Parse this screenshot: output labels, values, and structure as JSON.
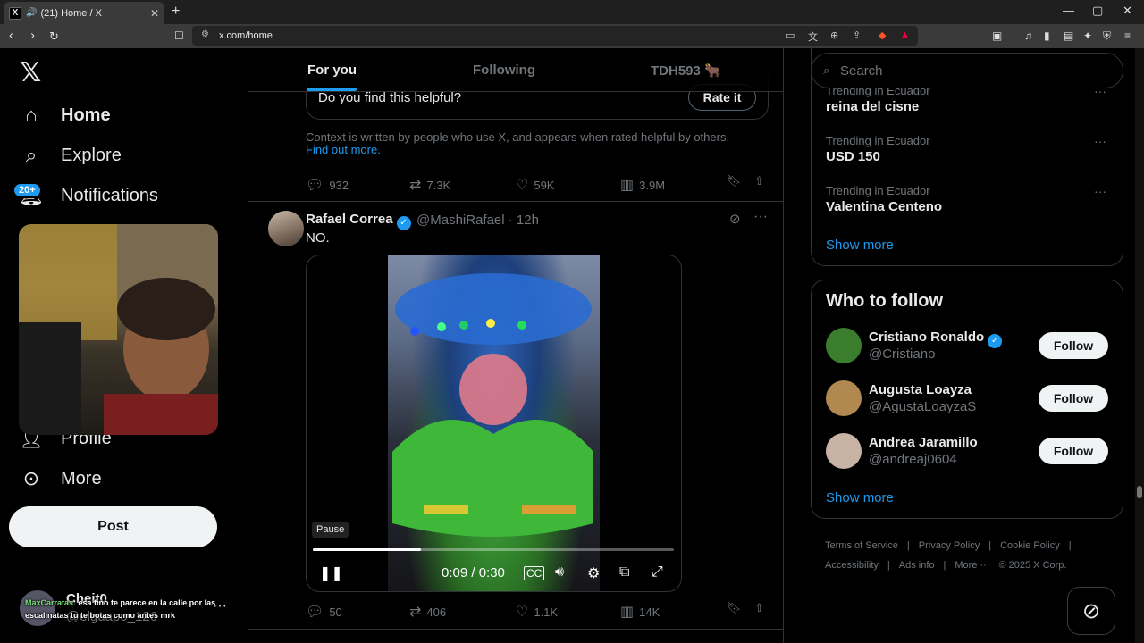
{
  "browser": {
    "tab_title": "(21) Home / X",
    "tab_favicon": "X",
    "new_tab": "+",
    "url": "x.com/home",
    "window_controls": [
      "—",
      "▢",
      "✕"
    ]
  },
  "nav": {
    "logo": "𝕏",
    "items": [
      {
        "label": "Home",
        "icon": "home-icon"
      },
      {
        "label": "Explore",
        "icon": "search-icon"
      },
      {
        "label": "Notifications",
        "icon": "bell-icon"
      },
      {
        "label": "Profile",
        "icon": "person-icon"
      },
      {
        "label": "More",
        "icon": "more-circle-icon"
      }
    ],
    "notifications_badge": "20+",
    "post_label": "Post",
    "account": {
      "name": "Cheit0",
      "handle": "@elguapo_126"
    }
  },
  "chat_overlay": {
    "user": "MaxCarratas",
    "message": ": esa fino te parece en la calle por las escalinatas tu te botas como antes mrk"
  },
  "feed": {
    "tabs": [
      "For you",
      "Following",
      "TDH593 🐂"
    ],
    "active_tab": 0,
    "note": {
      "question": "Do you find this helpful?",
      "rate_label": "Rate it",
      "context": "Context is written by people who use X, and appears when rated helpful by others.",
      "find_out_more": "Find out more."
    },
    "prev_actions": {
      "replies": "932",
      "reposts": "7.3K",
      "likes": "59K",
      "views": "3.9M"
    },
    "tweet": {
      "name": "Rafael Correa",
      "verified": "✓",
      "handle_time": "@MashiRafael · 12h",
      "text": "NO.",
      "video": {
        "tooltip": "Pause",
        "time": "0:09 / 0:30",
        "progress": 0.3
      },
      "actions": {
        "replies": "50",
        "reposts": "406",
        "likes": "1.1K",
        "views": "14K"
      }
    }
  },
  "sidebar": {
    "search_placeholder": "Search",
    "trends": [
      {
        "context": "Trending in Ecuador",
        "title": "reina del cisne"
      },
      {
        "context": "Trending in Ecuador",
        "title": "USD 150"
      },
      {
        "context": "Trending in Ecuador",
        "title": "Valentina Centeno"
      }
    ],
    "show_more": "Show more",
    "who_to_follow": {
      "title": "Who to follow",
      "users": [
        {
          "name": "Cristiano Ronaldo",
          "handle": "@Cristiano",
          "verified": true,
          "color": "#3a7d2c"
        },
        {
          "name": "Augusta Loayza",
          "handle": "@AgustaLoayzaS",
          "verified": false,
          "color": "#b08850"
        },
        {
          "name": "Andrea Jaramillo",
          "handle": "@andreaj0604",
          "verified": false,
          "color": "#c7b2a4"
        }
      ],
      "follow_label": "Follow",
      "show_more": "Show more"
    },
    "footer": [
      "Terms of Service",
      "|",
      "Privacy Policy",
      "|",
      "Cookie Policy",
      "|",
      "Accessibility",
      "|",
      "Ads info",
      "|",
      "More ···",
      "© 2025 X Corp."
    ]
  },
  "colors": {
    "accent": "#1d9bf0",
    "background": "#000000",
    "border": "#2f3336",
    "muted": "#71767b"
  }
}
